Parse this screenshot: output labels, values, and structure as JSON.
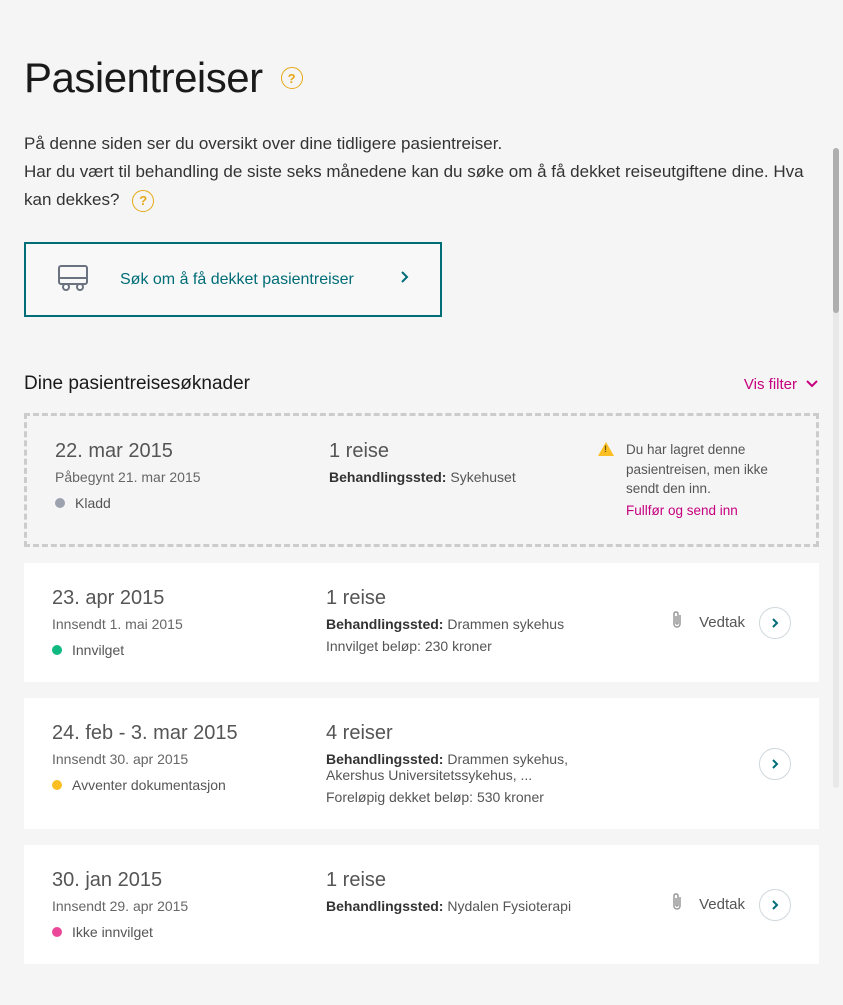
{
  "page": {
    "title": "Pasientreiser",
    "intro_line1": "På denne siden ser du oversikt over dine tidligere pasientreiser.",
    "intro_line2": "Har du vært til behandling de siste seks månedene kan du søke om å få dekket reiseutgiftene dine. Hva kan dekkes?"
  },
  "apply": {
    "label": "Søk om å få dekket pasientreiser"
  },
  "section": {
    "title": "Dine pasientreisesøknader",
    "filter_label": "Vis filter"
  },
  "labels": {
    "location_label": "Behandlingssted:",
    "attachment": "Vedtak"
  },
  "draft_card": {
    "date": "22. mar 2015",
    "subdate": "Påbegynt 21. mar 2015",
    "status": "Kladd",
    "trips": "1 reise",
    "location": "Sykehuset",
    "message": "Du har lagret denne pasientreisen, men ikke sendt den inn.",
    "action": "Fullfør og send inn"
  },
  "cards": [
    {
      "date": "23. apr 2015",
      "subdate": "Innsendt 1. mai 2015",
      "status": "Innvilget",
      "dot": "green",
      "trips": "1 reise",
      "location": "Drammen sykehus",
      "amount": "Innvilget beløp: 230 kroner",
      "has_attachment": true
    },
    {
      "date": "24. feb - 3. mar 2015",
      "subdate": "Innsendt 30. apr 2015",
      "status": "Avventer dokumentasjon",
      "dot": "yellow",
      "trips": "4 reiser",
      "location": "Drammen sykehus, Akershus Universitetssykehus, ...",
      "amount": "Foreløpig dekket beløp: 530 kroner",
      "has_attachment": false
    },
    {
      "date": "30. jan 2015",
      "subdate": "Innsendt 29. apr 2015",
      "status": "Ikke innvilget",
      "dot": "pink",
      "trips": "1 reise",
      "location": "Nydalen Fysioterapi",
      "amount": "",
      "has_attachment": true
    }
  ]
}
